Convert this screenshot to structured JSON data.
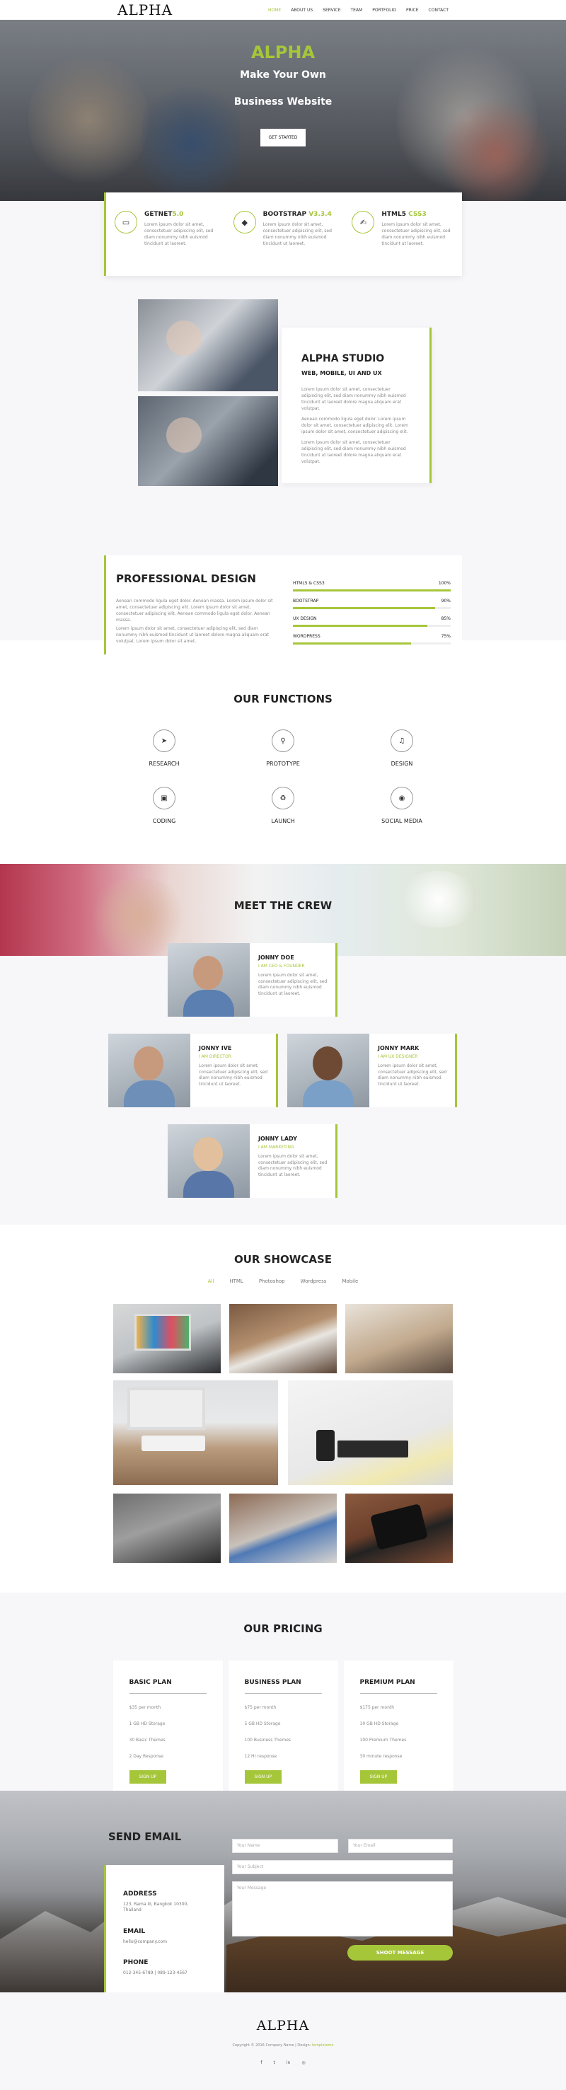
{
  "header": {
    "logo": "ALPHA",
    "nav": [
      "HOME",
      "ABOUT US",
      "SERVICE",
      "TEAM",
      "PORTFOLIO",
      "PRICE",
      "CONTACT"
    ],
    "active_index": 0
  },
  "hero": {
    "title": "ALPHA",
    "line1": "Make Your Own",
    "line2": "Business Website",
    "button": "GET STARTED"
  },
  "features": [
    {
      "icon": "monitor-icon",
      "glyph": "▭",
      "title": "GETNET",
      "accent": "5.0",
      "text": "Lorem ipsum dolor sit amet, consectetuer adipiscing elit, sed diam nonummy nibh euismod tincidunt ut laoreet."
    },
    {
      "icon": "tag-icon",
      "glyph": "◆",
      "title": "BOOTSTRAP ",
      "accent": "V3.3.4",
      "text": "Lorem ipsum dolor sit amet, consectetuer adipiscing elit, sed diam nonummy nibh euismod tincidunt ut laoreet."
    },
    {
      "icon": "thumbs-up-icon",
      "glyph": "✍",
      "title": "HTML5 ",
      "accent": "CSS3",
      "text": "Lorem ipsum dolor sit amet, consectetuer adipiscing elit, sed diam nonummy nibh euismod tincidunt ut laoreet."
    }
  ],
  "about": {
    "title": "ALPHA STUDIO",
    "subtitle": "WEB, MOBILE, UI AND UX",
    "paragraphs": [
      "Lorem ipsum dolor sit amet, consectetuer adipiscing elit, sed diam nonummy nibh euismod tincidunt ut laoreet dolore magna aliquam erat volutpat.",
      "Aenean commodo ligula eget dolor. Lorem ipsum dolor sit amet, consectetuer adipiscing elit. Lorem ipsum dolor sit amet, consectetuer adipiscing elit.",
      "Lorem ipsum dolor sit amet, consectetuer adipiscing elit, sed diam nonummy nibh euismod tincidunt ut laoreet dolore magna aliquam erat volutpat."
    ]
  },
  "professional": {
    "title": "PROFESSIONAL DESIGN",
    "paragraphs": [
      "Aenean commodo ligula eget dolor. Aenean massa. Lorem ipsum dolor sit amet, consectetuer adipiscing elit. Lorem ipsum dolor sit amet, consectetuer adipiscing elit. Aenean commodo ligula eget dolor. Aenean massa.",
      "Lorem ipsum dolor sit amet, consectetuer adipiscing elit, sed diam nonummy nibh euismod tincidunt ut laoreet dolore magna aliquam erat volutpat. Lorem ipsum dolor sit amet."
    ],
    "skills": [
      {
        "name": "HTML5 & CSS3",
        "percent": "100%",
        "value": 100
      },
      {
        "name": "BOOTSTRAP",
        "percent": "90%",
        "value": 90
      },
      {
        "name": "UX DESIGN",
        "percent": "85%",
        "value": 85
      },
      {
        "name": "WORDPRESS",
        "percent": "75%",
        "value": 75
      }
    ]
  },
  "functions": {
    "title": "OUR FUNCTIONS",
    "items": [
      {
        "label": "RESEARCH",
        "icon": "paper-plane-icon",
        "glyph": "➤"
      },
      {
        "label": "PROTOTYPE",
        "icon": "link-icon",
        "glyph": "⚲"
      },
      {
        "label": "DESIGN",
        "icon": "bell-icon",
        "glyph": "♫"
      },
      {
        "label": "CODING",
        "icon": "laptop-icon",
        "glyph": "▣"
      },
      {
        "label": "LAUNCH",
        "icon": "recycle-icon",
        "glyph": "♻"
      },
      {
        "label": "SOCIAL MEDIA",
        "icon": "globe-icon",
        "glyph": "◉"
      }
    ]
  },
  "crew": {
    "title": "MEET THE CREW",
    "members": [
      {
        "name": "JONNY DOE",
        "role": "I AM CEO & FOUNDER",
        "text": "Lorem ipsum dolor sit amet, consectetuer adipiscing elit, sed diam nonummy nibh euismod tincidunt ut laoreet."
      },
      {
        "name": "JONNY IVE",
        "role": "I AM DIRECTOR",
        "text": "Lorem ipsum dolor sit amet, consectetuer adipiscing elit, sed diam nonummy nibh euismod tincidunt ut laoreet."
      },
      {
        "name": "JONNY MARK",
        "role": "I AM UX DESIGNER",
        "text": "Lorem ipsum dolor sit amet, consectetuer adipiscing elit, sed diam nonummy nibh euismod tincidunt ut laoreet."
      },
      {
        "name": "JONNY LADY",
        "role": "I AM MARKETING",
        "text": "Lorem ipsum dolor sit amet, consectetuer adipiscing elit, sed diam nonummy nibh euismod tincidunt ut laoreet."
      }
    ]
  },
  "showcase": {
    "title": "OUR SHOWCASE",
    "filters": [
      "All",
      "HTML",
      "Photoshop",
      "Wordpress",
      "Mobile"
    ],
    "active_filter": 0
  },
  "pricing": {
    "title": "OUR PRICING",
    "plans": [
      {
        "name": "BASIC PLAN",
        "rows": [
          "$35 per month",
          "1 GB HD Storage",
          "30 Basic Themes",
          "2 Day Response"
        ],
        "button": "SIGN UP"
      },
      {
        "name": "BUSINESS PLAN",
        "rows": [
          "$75 per month",
          "5 GB HD Storage",
          "100 Business Themes",
          "12 Hr response"
        ],
        "button": "SIGN UP"
      },
      {
        "name": "PREMIUM PLAN",
        "rows": [
          "$175 per month",
          "10 GB HD Storage",
          "100 Premium Themes",
          "30 minute response"
        ],
        "button": "SIGN UP"
      }
    ]
  },
  "contact": {
    "title": "SEND EMAIL",
    "address_label": "ADDRESS",
    "address": "123, Rama III, Bangkok 10300, Thailand",
    "email_label": "EMAIL",
    "email": "hello@company.com",
    "phone_label": "PHONE",
    "phone": "012-345-6789 | 089-123-4567",
    "placeholders": {
      "name": "Your Name",
      "email": "Your Email",
      "subject": "Your Subject",
      "message": "Your Message"
    },
    "button": "SHOOT MESSAGE"
  },
  "footer": {
    "logo": "ALPHA",
    "copyright": "Copyright © 2016 Company Name | Design: ",
    "designer": "templatemo",
    "social": [
      "f",
      "t",
      "in",
      "◎"
    ]
  },
  "colors": {
    "accent": "#a6c63a",
    "dark": "#222222",
    "muted": "#888888"
  }
}
